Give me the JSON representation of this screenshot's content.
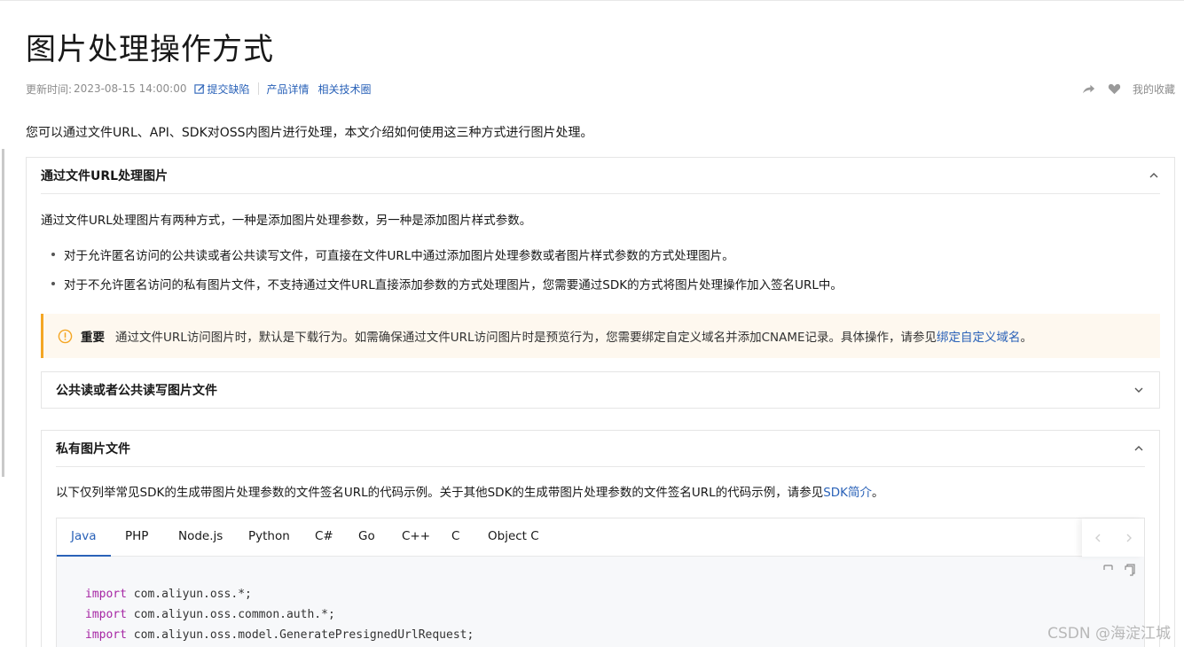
{
  "page": {
    "title": "图片处理操作方式",
    "meta": {
      "updated_label": "更新时间:",
      "updated_value": "2023-08-15 14:00:00",
      "submit_bug": "提交缺陷",
      "product_detail": "产品详情",
      "related_circle": "相关技术圈"
    },
    "actions": {
      "favorites": "我的收藏"
    },
    "intro": "您可以通过文件URL、API、SDK对OSS内图片进行处理，本文介绍如何使用这三种方式进行图片处理。"
  },
  "section_url": {
    "title": "通过文件URL处理图片",
    "para": "通过文件URL处理图片有两种方式，一种是添加图片处理参数，另一种是添加图片样式参数。",
    "bullets": [
      "对于允许匿名访问的公共读或者公共读写文件，可直接在文件URL中通过添加图片处理参数或者图片样式参数的方式处理图片。",
      "对于不允许匿名访问的私有图片文件，不支持通过文件URL直接添加参数的方式处理图片，您需要通过SDK的方式将图片处理操作加入签名URL中。"
    ],
    "note": {
      "label": "重要",
      "text": "通过文件URL访问图片时，默认是下载行为。如需确保通过文件URL访问图片时是预览行为，您需要绑定自定义域名并添加CNAME记录。具体操作，请参见",
      "link": "绑定自定义域名",
      "end": "。"
    },
    "public_sub": {
      "title": "公共读或者公共读写图片文件"
    },
    "private_sub": {
      "title": "私有图片文件",
      "para": "以下仅列举常见SDK的生成带图片处理参数的文件签名URL的代码示例。关于其他SDK的生成带图片处理参数的文件签名URL的代码示例，请参见",
      "link": "SDK简介",
      "end": "。",
      "tabs": [
        "Java",
        "PHP",
        "Node.js",
        "Python",
        "C#",
        "Go",
        "C++",
        "C",
        "Object C"
      ],
      "active_tab": "Java",
      "code_lines": [
        {
          "kw": "import",
          "rest": " com.aliyun.oss.*;"
        },
        {
          "kw": "import",
          "rest": " com.aliyun.oss.common.auth.*;"
        },
        {
          "kw": "import",
          "rest": " com.aliyun.oss.model.GeneratePresignedUrlRequest;"
        }
      ]
    }
  },
  "watermark": "CSDN @海淀江城",
  "colors": {
    "link": "#2a62b8",
    "keyword": "#a626a4",
    "warning": "#f4a624",
    "note_bg": "#fef8ef"
  }
}
